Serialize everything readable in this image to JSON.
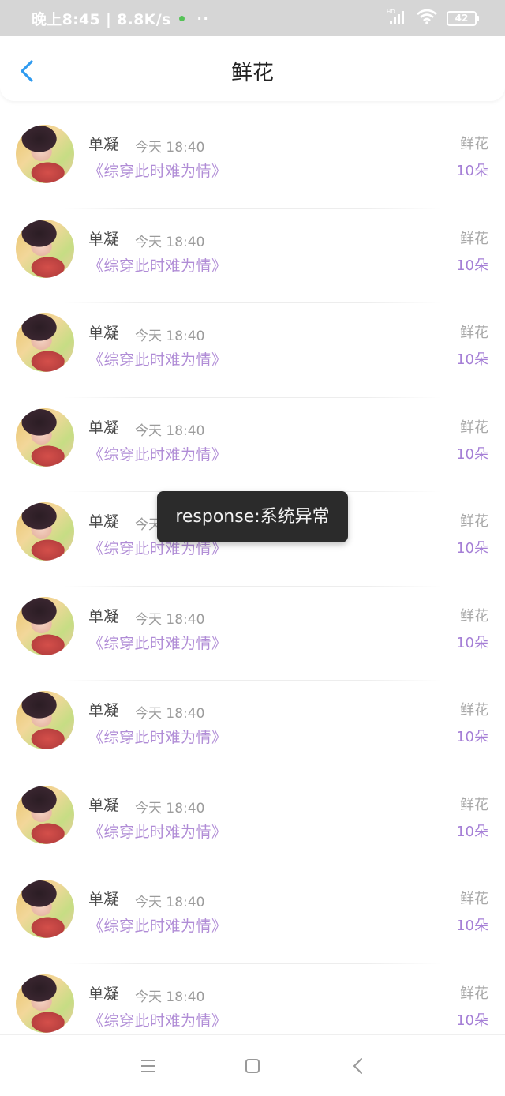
{
  "status_bar": {
    "time_speed": "晚上8:45 | 8.8K/s",
    "dots": "··",
    "network": "HD",
    "battery": "42"
  },
  "header": {
    "title": "鲜花"
  },
  "rows": [
    {
      "name": "单凝",
      "time": "今天 18:40",
      "book": "《综穿此时难为情》",
      "gift": "鲜花",
      "amount": "10朵"
    },
    {
      "name": "单凝",
      "time": "今天 18:40",
      "book": "《综穿此时难为情》",
      "gift": "鲜花",
      "amount": "10朵"
    },
    {
      "name": "单凝",
      "time": "今天 18:40",
      "book": "《综穿此时难为情》",
      "gift": "鲜花",
      "amount": "10朵"
    },
    {
      "name": "单凝",
      "time": "今天 18:40",
      "book": "《综穿此时难为情》",
      "gift": "鲜花",
      "amount": "10朵"
    },
    {
      "name": "单凝",
      "time": "今天 18:40",
      "book": "《综穿此时难为情》",
      "gift": "鲜花",
      "amount": "10朵"
    },
    {
      "name": "单凝",
      "time": "今天 18:40",
      "book": "《综穿此时难为情》",
      "gift": "鲜花",
      "amount": "10朵"
    },
    {
      "name": "单凝",
      "time": "今天 18:40",
      "book": "《综穿此时难为情》",
      "gift": "鲜花",
      "amount": "10朵"
    },
    {
      "name": "单凝",
      "time": "今天 18:40",
      "book": "《综穿此时难为情》",
      "gift": "鲜花",
      "amount": "10朵"
    },
    {
      "name": "单凝",
      "time": "今天 18:40",
      "book": "《综穿此时难为情》",
      "gift": "鲜花",
      "amount": "10朵"
    },
    {
      "name": "单凝",
      "time": "今天 18:40",
      "book": "《综穿此时难为情》",
      "gift": "鲜花",
      "amount": "10朵"
    }
  ],
  "toast": {
    "message": "response:系统异常"
  },
  "colors": {
    "accent_blue": "#2f9bf0",
    "book_purple": "#b08cd6",
    "amount_purple": "#a57fd6"
  },
  "icons": {
    "back": "chevron-left-icon",
    "nav_menu": "menu-icon",
    "nav_home": "square-icon",
    "nav_back": "chevron-left-icon"
  }
}
